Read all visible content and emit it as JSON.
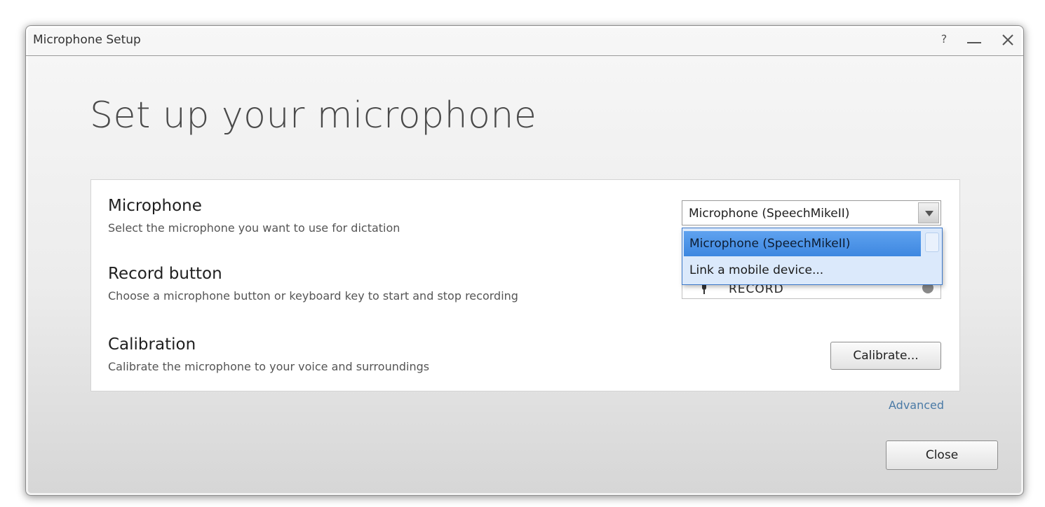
{
  "window": {
    "title": "Microphone Setup",
    "help_label": "?"
  },
  "page": {
    "heading": "Set up your microphone"
  },
  "settings": {
    "microphone": {
      "title": "Microphone",
      "description": "Select the microphone you want to use for dictation",
      "selected_value": "Microphone (SpeechMikeII)",
      "options": [
        "Microphone (SpeechMikeII)",
        "Link a mobile device..."
      ]
    },
    "record_button": {
      "title": "Record button",
      "description": "Choose a microphone button or keyboard key to start and stop recording",
      "value": "RECORD"
    },
    "calibration": {
      "title": "Calibration",
      "description": "Calibrate the microphone to your voice and surroundings",
      "button_label": "Calibrate..."
    }
  },
  "footer": {
    "advanced_label": "Advanced",
    "close_label": "Close"
  },
  "colors": {
    "dropdown_selected": "#3d87e0",
    "dropdown_bg": "#dbe9fb",
    "link": "#4a7aa6"
  },
  "icons": [
    "help-icon",
    "minimize-icon",
    "close-icon",
    "dropdown-arrow-icon",
    "microphone-icon",
    "clear-icon"
  ]
}
